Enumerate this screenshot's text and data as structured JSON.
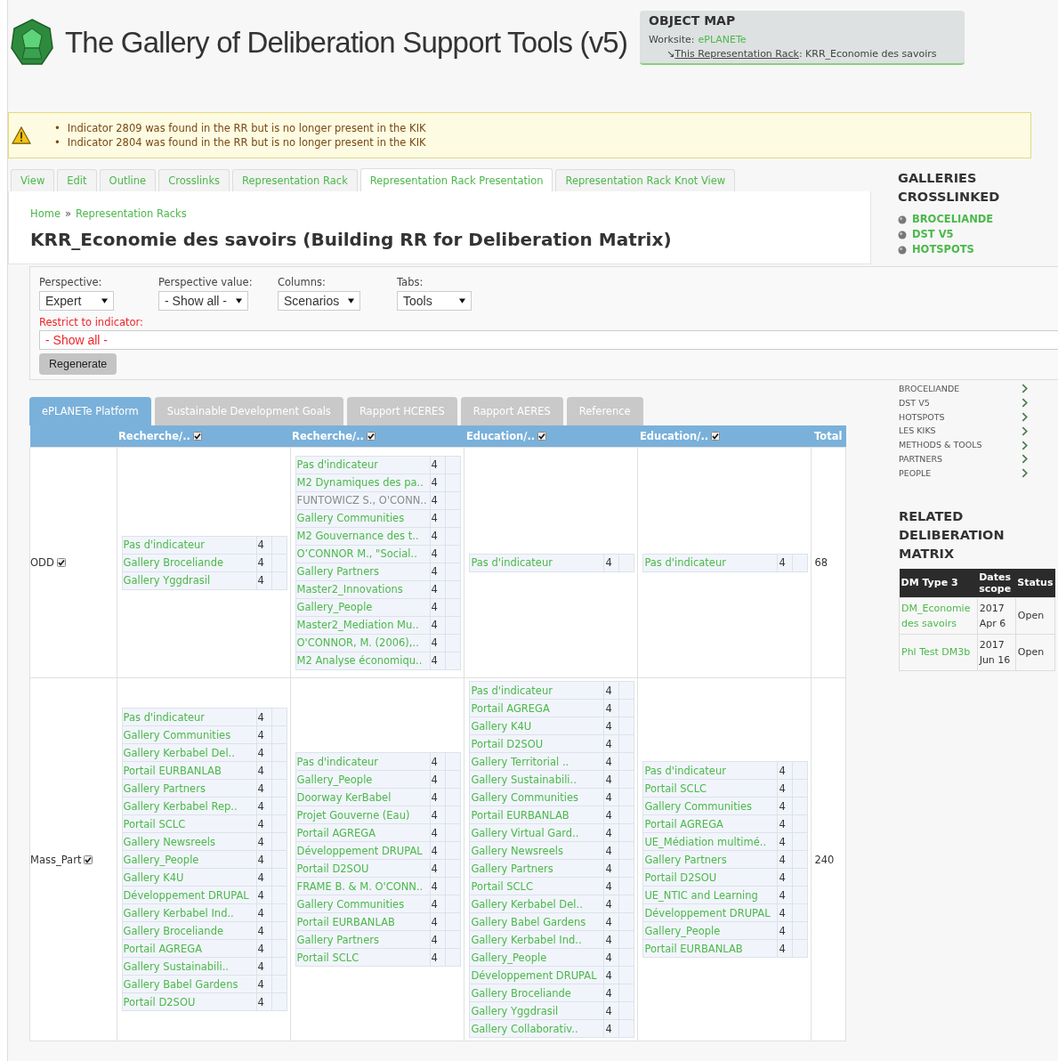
{
  "header": {
    "title": "The Gallery of Deliberation Support Tools (v5)"
  },
  "object_map": {
    "title": "OBJECT MAP",
    "worksite_label": "Worksite:",
    "worksite": "ePLANETe",
    "rack_arrow": "↘",
    "rack_label": "This Representation Rack",
    "rack_value": ": KRR_Economie des savoirs"
  },
  "warning_marker": "•",
  "warnings": [
    "Indicator 2809 was found in the RR but is no longer present in the KIK",
    "Indicator 2804 was found in the RR but is no longer present in the KIK"
  ],
  "tabs": [
    {
      "label": "View",
      "selected": false
    },
    {
      "label": "Edit",
      "selected": false
    },
    {
      "label": "Outline",
      "selected": false
    },
    {
      "label": "Crosslinks",
      "selected": false
    },
    {
      "label": "Representation Rack",
      "selected": false
    },
    {
      "label": "Representation Rack Presentation",
      "selected": true
    },
    {
      "label": "Representation Rack Knot View",
      "selected": false
    }
  ],
  "breadcrumb": {
    "items": [
      "Home",
      "Representation Racks"
    ],
    "separator": "»"
  },
  "page_title": "KRR_Economie des savoirs (Building RR for Deliberation Matrix)",
  "filters": {
    "selects": [
      {
        "label": "Perspective:",
        "value": "Expert"
      },
      {
        "label": "Perspective value:",
        "value": "- Show all -"
      },
      {
        "label": "Columns:",
        "value": "Scenarios"
      },
      {
        "label": "Tabs:",
        "value": "Tools"
      }
    ],
    "restrict": {
      "label": "Restrict to indicator:",
      "value": "- Show all -"
    },
    "button": "Regenerate"
  },
  "matrix": {
    "tabs": [
      {
        "label": "ePLANETe Platform",
        "selected": true
      },
      {
        "label": "Sustainable Development Goals",
        "selected": false
      },
      {
        "label": "Rapport HCERES",
        "selected": false
      },
      {
        "label": "Rapport AERES",
        "selected": false
      },
      {
        "label": "Reference",
        "selected": false
      }
    ],
    "columns": [
      {
        "label": "Recherche/..",
        "checked": true
      },
      {
        "label": "Recherche/..",
        "checked": true
      },
      {
        "label": "Education/..",
        "checked": true
      },
      {
        "label": "Education/..",
        "checked": true
      }
    ],
    "total_label": "Total",
    "rows": [
      {
        "label": "ODD",
        "checked": true,
        "total": "68",
        "cells": [
          [
            {
              "name": "Pas d'indicateur",
              "count": "4",
              "muted": false
            },
            {
              "name": "Gallery Broceliande",
              "count": "4",
              "muted": false
            },
            {
              "name": "Gallery Yggdrasil",
              "count": "4",
              "muted": false
            }
          ],
          [
            {
              "name": "Pas d'indicateur",
              "count": "4",
              "muted": false
            },
            {
              "name": "M2 Dynamiques des pa..",
              "count": "4",
              "muted": false
            },
            {
              "name": "FUNTOWICZ S., O'CONN..",
              "count": "4",
              "muted": true
            },
            {
              "name": "Gallery Communities",
              "count": "4",
              "muted": false
            },
            {
              "name": "M2 Gouvernance des t..",
              "count": "4",
              "muted": false
            },
            {
              "name": "O’CONNOR M., \"Social..",
              "count": "4",
              "muted": false
            },
            {
              "name": "Gallery Partners",
              "count": "4",
              "muted": false
            },
            {
              "name": "Master2_Innovations",
              "count": "4",
              "muted": false
            },
            {
              "name": "Gallery_People",
              "count": "4",
              "muted": false
            },
            {
              "name": "Master2_Mediation Mu..",
              "count": "4",
              "muted": false
            },
            {
              "name": "O'CONNOR, M. (2006),..",
              "count": "4",
              "muted": false
            },
            {
              "name": "M2 Analyse économiqu..",
              "count": "4",
              "muted": false
            }
          ],
          [
            {
              "name": "Pas d'indicateur",
              "count": "4",
              "muted": false
            }
          ],
          [
            {
              "name": "Pas d'indicateur",
              "count": "4",
              "muted": false
            }
          ]
        ]
      },
      {
        "label": "Mass_Part",
        "checked": true,
        "total": "240",
        "cells": [
          [
            {
              "name": "Pas d'indicateur",
              "count": "4",
              "muted": false
            },
            {
              "name": "Gallery Communities",
              "count": "4",
              "muted": false
            },
            {
              "name": "Gallery Kerbabel Del..",
              "count": "4",
              "muted": false
            },
            {
              "name": "Portail EURBANLAB",
              "count": "4",
              "muted": false
            },
            {
              "name": "Gallery Partners",
              "count": "4",
              "muted": false
            },
            {
              "name": "Gallery Kerbabel Rep..",
              "count": "4",
              "muted": false
            },
            {
              "name": "Portail SCLC",
              "count": "4",
              "muted": false
            },
            {
              "name": "Gallery Newsreels",
              "count": "4",
              "muted": false
            },
            {
              "name": "Gallery_People",
              "count": "4",
              "muted": false
            },
            {
              "name": "Gallery K4U",
              "count": "4",
              "muted": false
            },
            {
              "name": "Développement DRUPAL",
              "count": "4",
              "muted": false
            },
            {
              "name": "Gallery Kerbabel Ind..",
              "count": "4",
              "muted": false
            },
            {
              "name": "Gallery Broceliande",
              "count": "4",
              "muted": false
            },
            {
              "name": "Portail AGREGA",
              "count": "4",
              "muted": false
            },
            {
              "name": "Gallery Sustainabili..",
              "count": "4",
              "muted": false
            },
            {
              "name": "Gallery Babel Gardens",
              "count": "4",
              "muted": false
            },
            {
              "name": "Portail D2SOU",
              "count": "4",
              "muted": false
            }
          ],
          [
            {
              "name": "Pas d'indicateur",
              "count": "4",
              "muted": false
            },
            {
              "name": "Gallery_People",
              "count": "4",
              "muted": false
            },
            {
              "name": "Doorway KerBabel",
              "count": "4",
              "muted": false
            },
            {
              "name": "Projet Gouverne (Eau)",
              "count": "4",
              "muted": false
            },
            {
              "name": "Portail AGREGA",
              "count": "4",
              "muted": false
            },
            {
              "name": "Développement DRUPAL",
              "count": "4",
              "muted": false
            },
            {
              "name": "Portail D2SOU",
              "count": "4",
              "muted": false
            },
            {
              "name": "FRAME B. & M. O'CONN..",
              "count": "4",
              "muted": false
            },
            {
              "name": "Gallery Communities",
              "count": "4",
              "muted": false
            },
            {
              "name": "Portail EURBANLAB",
              "count": "4",
              "muted": false
            },
            {
              "name": "Gallery Partners",
              "count": "4",
              "muted": false
            },
            {
              "name": "Portail SCLC",
              "count": "4",
              "muted": false
            }
          ],
          [
            {
              "name": "Pas d'indicateur",
              "count": "4",
              "muted": false
            },
            {
              "name": "Portail AGREGA",
              "count": "4",
              "muted": false
            },
            {
              "name": "Gallery K4U",
              "count": "4",
              "muted": false
            },
            {
              "name": "Portail D2SOU",
              "count": "4",
              "muted": false
            },
            {
              "name": "Gallery Territorial ..",
              "count": "4",
              "muted": false
            },
            {
              "name": "Gallery Sustainabili..",
              "count": "4",
              "muted": false
            },
            {
              "name": "Gallery Communities",
              "count": "4",
              "muted": false
            },
            {
              "name": "Portail EURBANLAB",
              "count": "4",
              "muted": false
            },
            {
              "name": "Gallery Virtual Gard..",
              "count": "4",
              "muted": false
            },
            {
              "name": "Gallery Newsreels",
              "count": "4",
              "muted": false
            },
            {
              "name": "Gallery Partners",
              "count": "4",
              "muted": false
            },
            {
              "name": "Portail SCLC",
              "count": "4",
              "muted": false
            },
            {
              "name": "Gallery Kerbabel Del..",
              "count": "4",
              "muted": false
            },
            {
              "name": "Gallery Babel Gardens",
              "count": "4",
              "muted": false
            },
            {
              "name": "Gallery Kerbabel Ind..",
              "count": "4",
              "muted": false
            },
            {
              "name": "Gallery_People",
              "count": "4",
              "muted": false
            },
            {
              "name": "Développement DRUPAL",
              "count": "4",
              "muted": false
            },
            {
              "name": "Gallery Broceliande",
              "count": "4",
              "muted": false
            },
            {
              "name": "Gallery Yggdrasil",
              "count": "4",
              "muted": false
            },
            {
              "name": "Gallery Collaborativ..",
              "count": "4",
              "muted": false
            }
          ],
          [
            {
              "name": "Pas d'indicateur",
              "count": "4",
              "muted": false
            },
            {
              "name": "Portail SCLC",
              "count": "4",
              "muted": false
            },
            {
              "name": "Gallery Communities",
              "count": "4",
              "muted": false
            },
            {
              "name": "Portail AGREGA",
              "count": "4",
              "muted": false
            },
            {
              "name": "UE_Médiation multimé..",
              "count": "4",
              "muted": false
            },
            {
              "name": "Gallery Partners",
              "count": "4",
              "muted": false
            },
            {
              "name": "Portail D2SOU",
              "count": "4",
              "muted": false
            },
            {
              "name": "UE_NTIC and Learning",
              "count": "4",
              "muted": false
            },
            {
              "name": "Développement DRUPAL",
              "count": "4",
              "muted": false
            },
            {
              "name": "Gallery_People",
              "count": "4",
              "muted": false
            },
            {
              "name": "Portail EURBANLAB",
              "count": "4",
              "muted": false
            }
          ]
        ]
      }
    ]
  },
  "sidebar": {
    "galleries_title": "GALLERIES CROSSLINKED",
    "galleries": [
      "BROCELIANDE",
      "DST V5",
      "HOTSPOTS"
    ],
    "links": [
      "BROCELIANDE",
      "DST V5",
      "HOTSPOTS",
      "LES KIKS",
      "METHODS & TOOLS",
      "PARTNERS",
      "PEOPLE"
    ],
    "related_title": "RELATED DELIBERATION MATRIX",
    "dm_table": {
      "columns": [
        "DM Type 3",
        "Dates scope",
        "Status"
      ],
      "rows": [
        [
          "DM_Economie des savoirs",
          "2017 Apr 6",
          "Open"
        ],
        [
          "Phl Test DM3b",
          "2017 Jun 16",
          "Open"
        ]
      ]
    }
  }
}
